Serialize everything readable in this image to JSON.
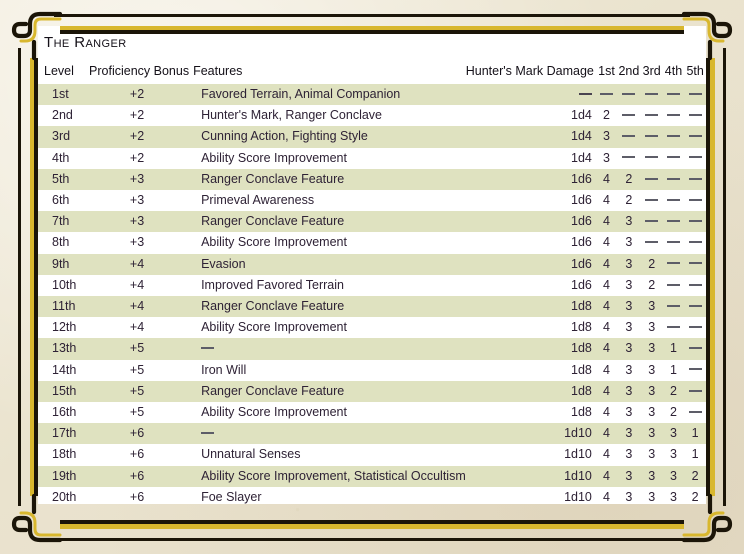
{
  "title": "The Ranger",
  "colors": {
    "parchment": "#eae3ce",
    "frame_dark": "#1b1508",
    "frame_gold": "#d8b72e",
    "row_shade": "#dfe2c0",
    "card": "#ffffff",
    "text": "#2e2235"
  },
  "columns": {
    "level": "Level",
    "proficiency_bonus": "Proficiency Bonus",
    "features": "Features",
    "hunters_mark_damage": "Hunter's Mark Damage",
    "spell_slots": [
      "1st",
      "2nd",
      "3rd",
      "4th",
      "5th"
    ]
  },
  "dash": "—",
  "chart_data": {
    "type": "table",
    "title": "The Ranger",
    "columns": [
      "Level",
      "Proficiency Bonus",
      "Features",
      "Hunter's Mark Damage",
      "1st",
      "2nd",
      "3rd",
      "4th",
      "5th"
    ],
    "rows": [
      [
        "1st",
        "+2",
        "Favored Terrain, Animal Companion",
        "—",
        "—",
        "—",
        "—",
        "—",
        "—"
      ],
      [
        "2nd",
        "+2",
        "Hunter's Mark, Ranger Conclave",
        "1d4",
        "2",
        "—",
        "—",
        "—",
        "—"
      ],
      [
        "3rd",
        "+2",
        "Cunning Action, Fighting Style",
        "1d4",
        "3",
        "—",
        "—",
        "—",
        "—"
      ],
      [
        "4th",
        "+2",
        "Ability Score Improvement",
        "1d4",
        "3",
        "—",
        "—",
        "—",
        "—"
      ],
      [
        "5th",
        "+3",
        "Ranger Conclave Feature",
        "1d6",
        "4",
        "2",
        "—",
        "—",
        "—"
      ],
      [
        "6th",
        "+3",
        "Primeval Awareness",
        "1d6",
        "4",
        "2",
        "—",
        "—",
        "—"
      ],
      [
        "7th",
        "+3",
        "Ranger Conclave Feature",
        "1d6",
        "4",
        "3",
        "—",
        "—",
        "—"
      ],
      [
        "8th",
        "+3",
        "Ability Score Improvement",
        "1d6",
        "4",
        "3",
        "—",
        "—",
        "—"
      ],
      [
        "9th",
        "+4",
        "Evasion",
        "1d6",
        "4",
        "3",
        "2",
        "—",
        "—"
      ],
      [
        "10th",
        "+4",
        "Improved Favored Terrain",
        "1d6",
        "4",
        "3",
        "2",
        "—",
        "—"
      ],
      [
        "11th",
        "+4",
        "Ranger Conclave Feature",
        "1d8",
        "4",
        "3",
        "3",
        "—",
        "—"
      ],
      [
        "12th",
        "+4",
        "Ability Score Improvement",
        "1d8",
        "4",
        "3",
        "3",
        "—",
        "—"
      ],
      [
        "13th",
        "+5",
        "—",
        "1d8",
        "4",
        "3",
        "3",
        "1",
        "—"
      ],
      [
        "14th",
        "+5",
        "Iron Will",
        "1d8",
        "4",
        "3",
        "3",
        "1",
        "—"
      ],
      [
        "15th",
        "+5",
        "Ranger Conclave Feature",
        "1d8",
        "4",
        "3",
        "3",
        "2",
        "—"
      ],
      [
        "16th",
        "+5",
        "Ability Score Improvement",
        "1d8",
        "4",
        "3",
        "3",
        "2",
        "—"
      ],
      [
        "17th",
        "+6",
        "—",
        "1d10",
        "4",
        "3",
        "3",
        "3",
        "1"
      ],
      [
        "18th",
        "+6",
        "Unnatural Senses",
        "1d10",
        "4",
        "3",
        "3",
        "3",
        "1"
      ],
      [
        "19th",
        "+6",
        "Ability Score Improvement, Statistical Occultism",
        "1d10",
        "4",
        "3",
        "3",
        "3",
        "2"
      ],
      [
        "20th",
        "+6",
        "Foe Slayer",
        "1d10",
        "4",
        "3",
        "3",
        "3",
        "2"
      ]
    ]
  }
}
